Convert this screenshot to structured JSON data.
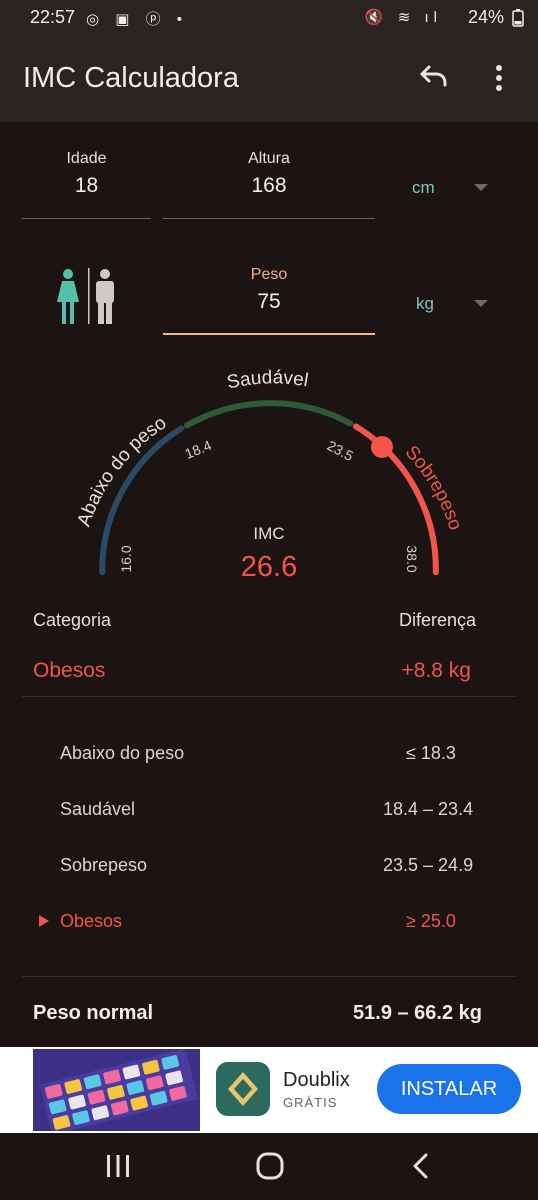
{
  "status": {
    "time": "22:57",
    "left_icons": "◎ ▣ ⓟ •",
    "right_icons": "🔇 ≋ ıl",
    "battery": "24%"
  },
  "appbar": {
    "title": "IMC Calculadora",
    "undo_icon": "undo-icon",
    "more_icon": "more-vert-icon"
  },
  "inputs": {
    "age": {
      "label": "Idade",
      "value": "18"
    },
    "height": {
      "label": "Altura",
      "value": "168",
      "unit": "cm"
    },
    "weight": {
      "label": "Peso",
      "value": "75",
      "unit": "kg"
    }
  },
  "gauge": {
    "label": "IMC",
    "value": "26.6",
    "value_num": 26.6,
    "segments": [
      {
        "name": "Abaixo do peso",
        "color": "#2a4a66"
      },
      {
        "name": "Saudável",
        "color": "#2f5a36"
      },
      {
        "name": "Sobrepeso",
        "color": "#f2554a"
      }
    ],
    "ticks": [
      "16.0",
      "18.4",
      "23.5",
      "38.0"
    ]
  },
  "result": {
    "category_header": "Categoria",
    "difference_header": "Diferença",
    "category": "Obesos",
    "difference": "+8.8 kg",
    "accent_color": "#f2554a"
  },
  "table": [
    {
      "name": "Abaixo do peso",
      "range": "≤ 18.3",
      "active": false
    },
    {
      "name": "Saudável",
      "range": "18.4 – 23.4",
      "active": false
    },
    {
      "name": "Sobrepeso",
      "range": "23.5 – 24.9",
      "active": false
    },
    {
      "name": "Obesos",
      "range": "≥ 25.0",
      "active": true
    }
  ],
  "normal_weight": {
    "label": "Peso normal",
    "value": "51.9 – 66.2 kg"
  },
  "ad": {
    "name": "Doublix",
    "sub": "GRÁTIS",
    "button": "INSTALAR"
  },
  "nav": {
    "recents": "recents-icon",
    "home": "home-icon",
    "back": "back-icon"
  }
}
